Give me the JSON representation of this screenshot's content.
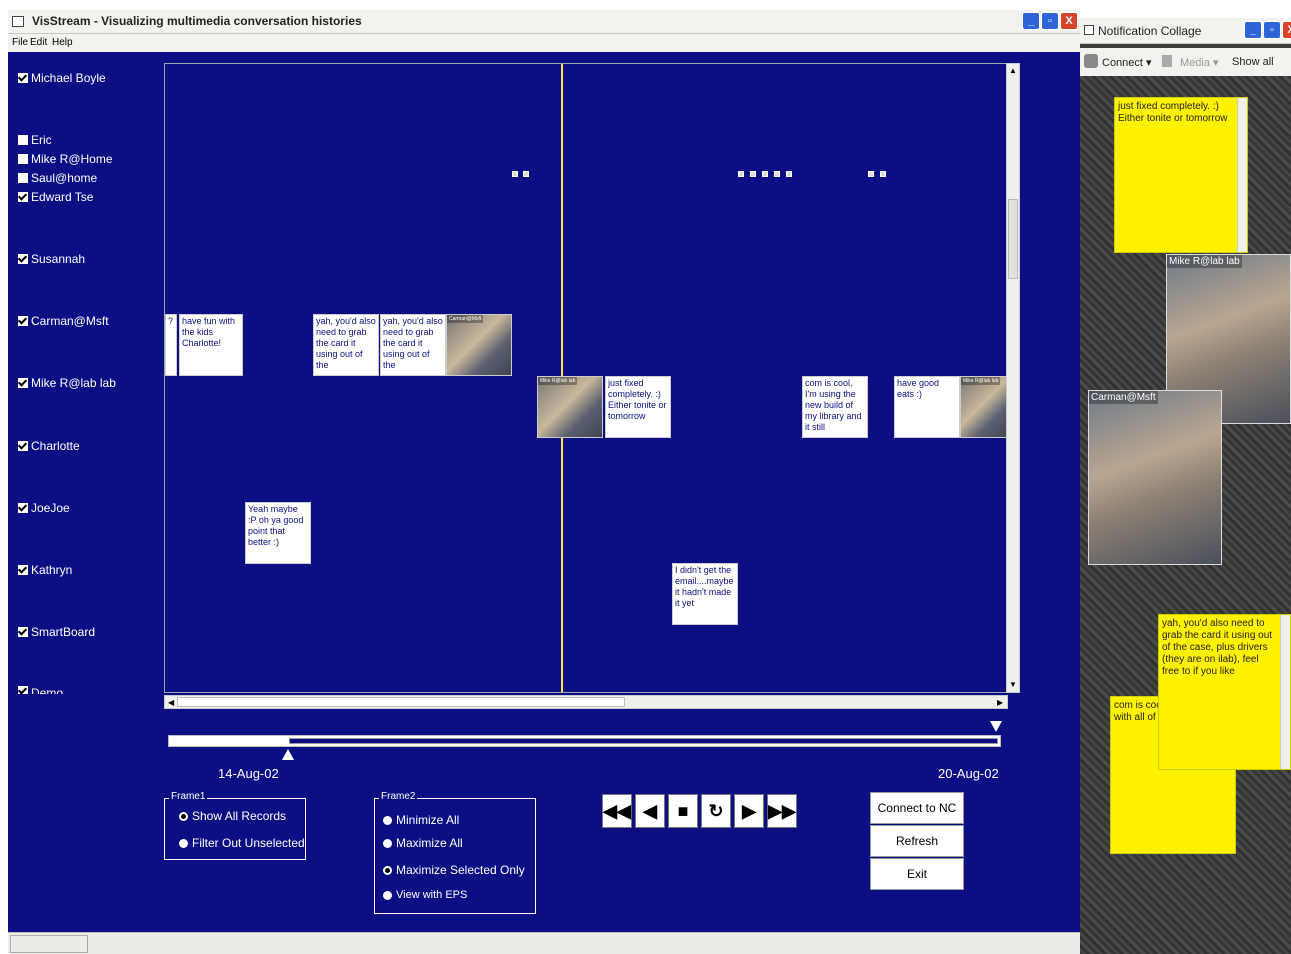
{
  "window": {
    "title": "VisStream - Visualizing multimedia conversation histories",
    "buttons": [
      "_",
      "▫",
      "X"
    ]
  },
  "menu": [
    "File",
    "Edit",
    "Help"
  ],
  "people": [
    {
      "name": "Michael Boyle",
      "checked": true
    },
    {
      "name": "Eric",
      "checked": false
    },
    {
      "name": "Mike R@Home",
      "checked": false
    },
    {
      "name": "Saul@home",
      "checked": false
    },
    {
      "name": "Edward Tse",
      "checked": true
    },
    {
      "name": "Susannah",
      "checked": true
    },
    {
      "name": "Carman@Msft",
      "checked": true
    },
    {
      "name": "Mike R@lab lab",
      "checked": true
    },
    {
      "name": "Charlotte",
      "checked": true
    },
    {
      "name": "JoeJoe",
      "checked": true
    },
    {
      "name": "Kathryn",
      "checked": true
    },
    {
      "name": "SmartBoard",
      "checked": true
    },
    {
      "name": "Demo",
      "checked": true
    }
  ],
  "timeline": {
    "messages": [
      "?",
      "have fun with the kids Charlotte!",
      "yah, you'd also need to grab the card it using out of the",
      "yah, you'd also need to grab the card it using out of the",
      "just fixed completely. :) Either tonite or tomorrow",
      "com is cool, I'm using the new build of my library and it still",
      "have good eats :)",
      "Yeah maybe :P oh ya good point that better :)",
      "I didn't get the email....maybe it hadn't made it yet"
    ],
    "thumb_labels": [
      "Carman@Msft",
      "Mike R@lab lab",
      "Mike R@lab lab"
    ]
  },
  "range": {
    "start_date": "14-Aug-02",
    "end_date": "20-Aug-02",
    "selection_start_fraction": 0.145,
    "selection_end_fraction": 1.0
  },
  "frame1": {
    "title": "Frame1",
    "options": [
      {
        "label": "Show All Records",
        "selected": true
      },
      {
        "label": "Filter Out Unselected",
        "selected": false
      }
    ]
  },
  "frame2": {
    "title": "Frame2",
    "options": [
      {
        "label": "Minimize All",
        "selected": false
      },
      {
        "label": "Maximize All",
        "selected": false
      },
      {
        "label": "Maximize Selected Only",
        "selected": true
      },
      {
        "label": "View with EPS",
        "selected": false
      }
    ]
  },
  "playback": {
    "rewind": "◀◀",
    "step_back": "◀",
    "stop": "■",
    "loop": "↻",
    "play": "▶",
    "fast_forward": "▶▶"
  },
  "actions": {
    "connect": "Connect to NC",
    "refresh": "Refresh",
    "exit": "Exit"
  },
  "nc": {
    "title": "Notification Collage",
    "toolbar": {
      "connect": "Connect ▾",
      "media": "Media ▾",
      "show_all": "Show all"
    },
    "stickies": [
      "just fixed completely. :) Either tonite or tomorrow",
      "yah, you'd also need to grab the card it using out of the case, plus drivers (they are on ilab), feel free to if you like",
      "com is cool, build of my li with all of thi"
    ],
    "video_labels": [
      "Mike R@lab lab",
      "Carman@Msft"
    ]
  }
}
